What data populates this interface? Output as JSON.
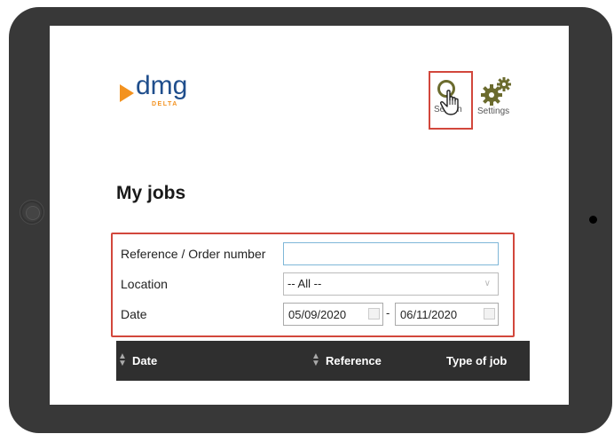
{
  "logo": {
    "text": "dmg",
    "sub": "DELTA"
  },
  "nav": {
    "search_label": "Search",
    "settings_label": "Settings",
    "search_icon": "magnifier-icon",
    "settings_icon": "gears-icon"
  },
  "page": {
    "title": "My jobs"
  },
  "filters": {
    "reference_label": "Reference / Order number",
    "reference_value": "",
    "location_label": "Location",
    "location_value": "-- All --",
    "date_label": "Date",
    "date_from": "05/09/2020",
    "date_separator": "-",
    "date_to": "06/11/2020"
  },
  "table": {
    "columns": [
      "Date",
      "Reference",
      "Type of job"
    ]
  },
  "colors": {
    "highlight": "#d2473c",
    "brand_blue": "#1f4e8c",
    "brand_orange": "#f3921f",
    "header_bg": "#2f2f2f"
  }
}
